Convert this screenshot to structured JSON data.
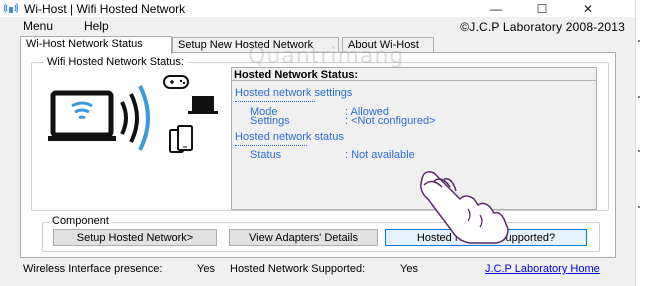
{
  "window": {
    "title": "Wi-Host | Wifi Hosted Network",
    "minimize_glyph": "—",
    "maximize_glyph": "☐",
    "close_glyph": "✕"
  },
  "menu": {
    "items": [
      "Menu",
      "Help"
    ],
    "copyright": "©J.C.P Laboratory 2008-2013"
  },
  "tabs": [
    {
      "label": "Wi-Host Network Status",
      "active": true
    },
    {
      "label": "Setup New Hosted Network",
      "active": false
    },
    {
      "label": "About Wi-Host",
      "active": false
    }
  ],
  "status_group": {
    "label": "Wifi Hosted Network Status:"
  },
  "watermark": "Quantrimang",
  "status_panel": {
    "title": "Hosted Network Status:",
    "settings_section": "Hosted network settings",
    "mode_key": "Mode",
    "mode_value": ": Allowed",
    "settings_key": "Settings",
    "settings_value": ": <Not configured>",
    "status_section": "Hosted network status",
    "status_key": "Status",
    "status_value": ": Not available"
  },
  "component": {
    "label": "Component",
    "buttons": [
      "Setup Hosted Network>",
      "View Adapters' Details",
      "Hosted Network Supported?"
    ]
  },
  "statusbar": {
    "presence_label": "Wireless Interface presence:",
    "presence_value": "Yes",
    "supported_label": "Hosted Network Supported:",
    "supported_value": "Yes",
    "home_link": "J.C.P Laboratory Home"
  },
  "colors": {
    "accent_blue": "#2b6fd6",
    "link": "#0000ee",
    "window_bg": "#f0f0f0"
  },
  "icons": [
    "wifi-icon",
    "laptop-icon",
    "gamepad-icon",
    "tablet-icon",
    "phone-icon",
    "hand-cursor-icon"
  ]
}
